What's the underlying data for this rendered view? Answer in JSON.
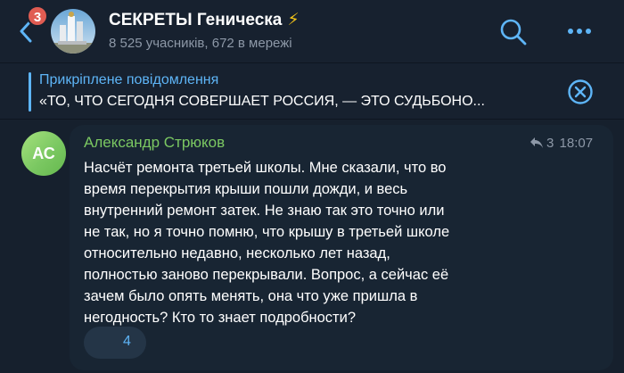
{
  "header": {
    "unread_count": "3",
    "title": "СЕКРЕТЫ Геническа",
    "title_emoji": "⚡",
    "subtitle": "8 525 учасників, 672 в мережі"
  },
  "pinned": {
    "label": "Прикріплене повідомлення",
    "text": "«ТО, ЧТО СЕГОДНЯ СОВЕРШАЕТ РОССИЯ, — ЭТО СУДЬБОНО..."
  },
  "message": {
    "avatar_initials": "АС",
    "sender": "Александр Стрюков",
    "reply_count": "3",
    "time": "18:07",
    "lines": [
      "Насчёт ремонта третьей школы. Мне сказали, что во",
      "время перекрытия крыши пошли дожди, и весь",
      "внутренний ремонт затек. Не знаю так это точно или",
      "не так, но я точно помню, что крышу в третьей школе",
      "относительно недавно, несколько лет назад,",
      "полностью заново перекрывали. Вопрос, а сейчас её",
      "зачем было опять менять, она что уже пришла в",
      "негодность? Кто то знает подробности?"
    ],
    "reaction_count": "4"
  },
  "colors": {
    "background": "#16202d",
    "header": "#17212f",
    "accent": "#5eb5f7",
    "sender": "#7bc862",
    "badge": "#e05c52",
    "bubble": "#182533"
  }
}
